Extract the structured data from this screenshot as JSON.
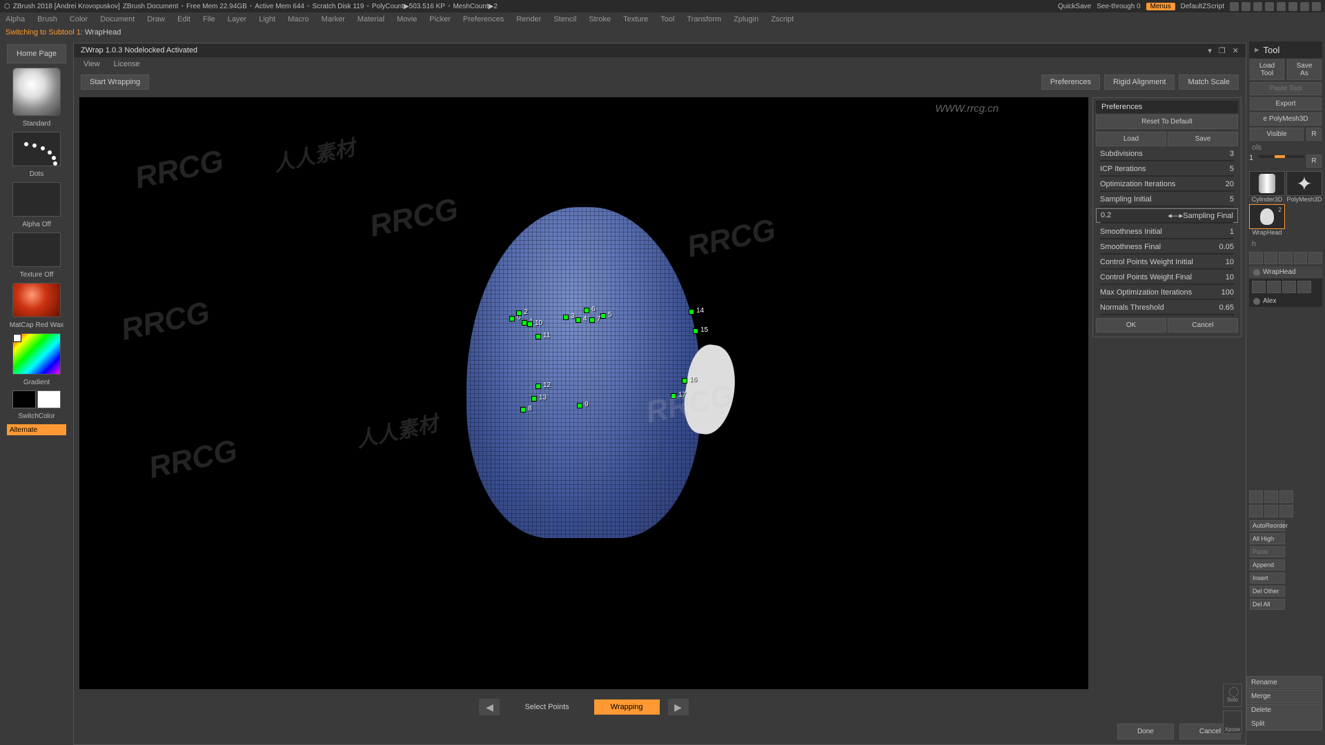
{
  "topbar": {
    "app": "ZBrush 2018 [Andrei Krovopuskov]",
    "doc": "ZBrush Document",
    "freemem": "Free Mem 22.94GB",
    "activemem": "Active Mem 644",
    "scratch": "Scratch Disk 119",
    "polycount": "PolyCount▶503.516 KP",
    "meshcount": "MeshCount▶2",
    "quicksave": "QuickSave",
    "seethrough": "See-through  0",
    "menus": "Menus",
    "zscript": "DefaultZScript"
  },
  "menus": [
    "Alpha",
    "Brush",
    "Color",
    "Document",
    "Draw",
    "Edit",
    "File",
    "Layer",
    "Light",
    "Macro",
    "Marker",
    "Material",
    "Movie",
    "Picker",
    "Preferences",
    "Render",
    "Stencil",
    "Stroke",
    "Texture",
    "Tool",
    "Transform",
    "Zplugin",
    "Zscript"
  ],
  "status": {
    "switching": "Switching to Subtool 1:",
    "name": "WrapHead"
  },
  "left": {
    "homepage": "Home Page",
    "standard": "Standard",
    "dots": "Dots",
    "alphaoff": "Alpha Off",
    "textureoff": "Texture Off",
    "matcap": "MatCap Red Wax",
    "gradient": "Gradient",
    "switchcolor": "SwitchColor",
    "alternate": "Alternate"
  },
  "zwrap": {
    "title": "ZWrap 1.0.3  Nodelocked Activated",
    "view": "View",
    "license": "License",
    "start": "Start Wrapping",
    "prefs": "Preferences",
    "rigid": "Rigid Alignment",
    "match": "Match Scale",
    "selectpoints": "Select Points",
    "wrapping": "Wrapping",
    "done": "Done",
    "cancel": "Cancel"
  },
  "prefpanel": {
    "header": "Preferences",
    "reset": "Reset To Default",
    "load": "Load",
    "save": "Save",
    "subdivisions": {
      "l": "Subdivisions",
      "v": "3"
    },
    "icp": {
      "l": "ICP Iterations",
      "v": "5"
    },
    "opt": {
      "l": "Optimization Iterations",
      "v": "20"
    },
    "sampinit": {
      "l": "Sampling Initial",
      "v": "5"
    },
    "sampfinal": {
      "l": "Sampling Final",
      "v": "0.2"
    },
    "smoothinit": {
      "l": "Smoothness Initial",
      "v": "1"
    },
    "smoothfinal": {
      "l": "Smoothness Final",
      "v": "0.05"
    },
    "cpinit": {
      "l": "Control Points Weight Initial",
      "v": "10"
    },
    "cpfinal": {
      "l": "Control Points Weight Final",
      "v": "10"
    },
    "maxopt": {
      "l": "Max Optimization Iterations",
      "v": "100"
    },
    "normals": {
      "l": "Normals Threshold",
      "v": "0.65"
    },
    "ok": "OK",
    "cancel": "Cancel"
  },
  "tool": {
    "header": "Tool",
    "loadtool": "Load Tool",
    "saveas": "Save As",
    "pastetool": "Paste Tool",
    "export": "Export",
    "makepoly": "e PolyMesh3D",
    "visible": "Visible",
    "r": "R",
    "tools_label": "ols",
    "slider1": "1",
    "slider2": "2",
    "items": [
      {
        "name": "Cylinder3D"
      },
      {
        "name": "PolyMesh3D"
      },
      {
        "name": "WrapHead"
      }
    ],
    "subtool_label": "h",
    "subtools": [
      {
        "n": "WrapHead"
      },
      {
        "n": "Alex"
      }
    ],
    "buttons": [
      "AutoReorder",
      "All High",
      "Paste",
      "Append",
      "Insert",
      "Del Other",
      "Del All"
    ],
    "side": [
      "Rename",
      "Merge",
      "Delete",
      "Split"
    ]
  },
  "watermark": "RRCG",
  "watermark_cn": "人人素材",
  "url": "WWW.rrcg.cn"
}
